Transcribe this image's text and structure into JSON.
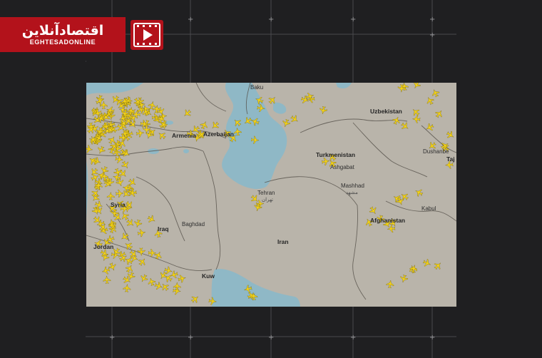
{
  "brand": {
    "name_fa": "اقتصادآنلاین",
    "name_en": "EGHTESADONLINE",
    "color": "#b3121b"
  },
  "video_icon": {
    "name": "play-video-icon"
  },
  "map": {
    "water_color": "#8fb8c6",
    "land_color": "#b9b4aa",
    "aircraft_color": "#f2d11a",
    "labels": [
      {
        "key": "uzbekistan",
        "text": "Uzbekistan",
        "kind": "country"
      },
      {
        "key": "turkmenistan",
        "text": "Turkmenistan",
        "kind": "country"
      },
      {
        "key": "azerbaijan",
        "text": "Azerbaijan",
        "kind": "country"
      },
      {
        "key": "armenia",
        "text": "Armenia",
        "kind": "country"
      },
      {
        "key": "syria",
        "text": "Syria",
        "kind": "country"
      },
      {
        "key": "jordan",
        "text": "Jordan",
        "kind": "country"
      },
      {
        "key": "iran",
        "text": "Iran",
        "kind": "country"
      },
      {
        "key": "afghanistan",
        "text": "Afghanistan",
        "kind": "country"
      },
      {
        "key": "tajikistan",
        "text": "Taj",
        "kind": "country"
      },
      {
        "key": "kuwait",
        "text": "Kuw",
        "kind": "country"
      },
      {
        "key": "iraq",
        "text": "Iraq",
        "kind": "country"
      },
      {
        "key": "tehran",
        "text": "Tehran",
        "kind": "city"
      },
      {
        "key": "tehran_fa",
        "text": "تهران",
        "kind": "sub"
      },
      {
        "key": "mashhad",
        "text": "Mashhad",
        "kind": "city"
      },
      {
        "key": "mashhad_fa",
        "text": "مشهد",
        "kind": "sub"
      },
      {
        "key": "ashgabat",
        "text": "Ashgabat",
        "kind": "city"
      },
      {
        "key": "baghdad",
        "text": "Baghdad",
        "kind": "city"
      },
      {
        "key": "dushanbe",
        "text": "Dushanbe",
        "kind": "city"
      },
      {
        "key": "kabul",
        "text": "Kabul",
        "kind": "city"
      },
      {
        "key": "baku",
        "text": "Baku",
        "kind": "city"
      }
    ]
  }
}
